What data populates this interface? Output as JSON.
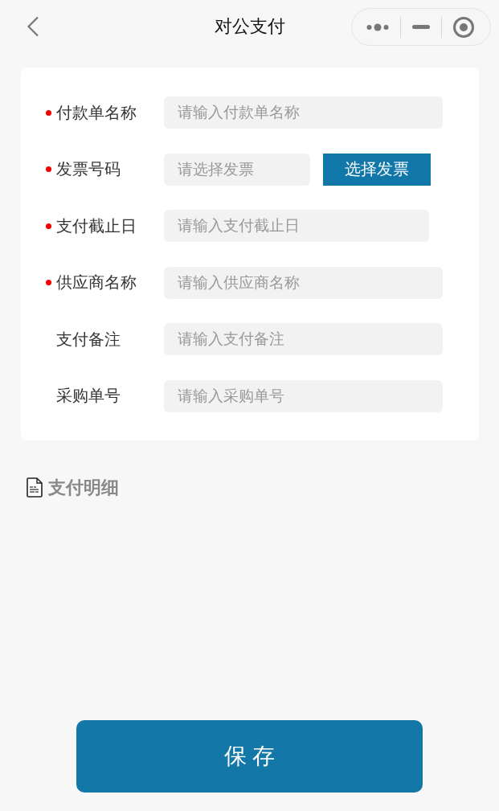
{
  "header": {
    "title": "对公支付"
  },
  "form": {
    "fields": [
      {
        "kind": "text",
        "label": "付款单名称",
        "required": true,
        "placeholder": "请输入付款单名称"
      },
      {
        "kind": "picker",
        "label": "发票号码",
        "required": true,
        "placeholder": "请选择发票",
        "button": "选择发票"
      },
      {
        "kind": "date",
        "label": "支付截止日",
        "required": true,
        "placeholder": "请输入支付截止日"
      },
      {
        "kind": "text",
        "label": "供应商名称",
        "required": true,
        "placeholder": "请输入供应商名称"
      },
      {
        "kind": "text",
        "label": "支付备注",
        "required": false,
        "placeholder": "请输入支付备注"
      },
      {
        "kind": "text",
        "label": "采购单号",
        "required": false,
        "placeholder": "请输入采购单号"
      }
    ]
  },
  "section": {
    "title": "支付明细"
  },
  "save_button": {
    "label": "保 存"
  }
}
